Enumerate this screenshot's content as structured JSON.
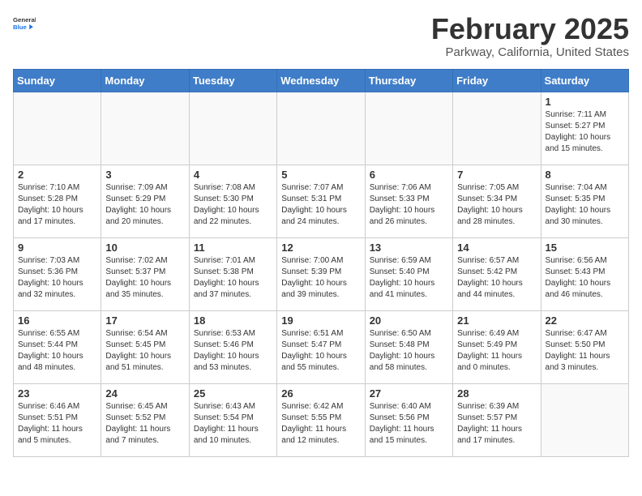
{
  "header": {
    "logo_general": "General",
    "logo_blue": "Blue",
    "month_title": "February 2025",
    "location": "Parkway, California, United States"
  },
  "weekdays": [
    "Sunday",
    "Monday",
    "Tuesday",
    "Wednesday",
    "Thursday",
    "Friday",
    "Saturday"
  ],
  "weeks": [
    [
      {
        "day": "",
        "info": ""
      },
      {
        "day": "",
        "info": ""
      },
      {
        "day": "",
        "info": ""
      },
      {
        "day": "",
        "info": ""
      },
      {
        "day": "",
        "info": ""
      },
      {
        "day": "",
        "info": ""
      },
      {
        "day": "1",
        "info": "Sunrise: 7:11 AM\nSunset: 5:27 PM\nDaylight: 10 hours\nand 15 minutes."
      }
    ],
    [
      {
        "day": "2",
        "info": "Sunrise: 7:10 AM\nSunset: 5:28 PM\nDaylight: 10 hours\nand 17 minutes."
      },
      {
        "day": "3",
        "info": "Sunrise: 7:09 AM\nSunset: 5:29 PM\nDaylight: 10 hours\nand 20 minutes."
      },
      {
        "day": "4",
        "info": "Sunrise: 7:08 AM\nSunset: 5:30 PM\nDaylight: 10 hours\nand 22 minutes."
      },
      {
        "day": "5",
        "info": "Sunrise: 7:07 AM\nSunset: 5:31 PM\nDaylight: 10 hours\nand 24 minutes."
      },
      {
        "day": "6",
        "info": "Sunrise: 7:06 AM\nSunset: 5:33 PM\nDaylight: 10 hours\nand 26 minutes."
      },
      {
        "day": "7",
        "info": "Sunrise: 7:05 AM\nSunset: 5:34 PM\nDaylight: 10 hours\nand 28 minutes."
      },
      {
        "day": "8",
        "info": "Sunrise: 7:04 AM\nSunset: 5:35 PM\nDaylight: 10 hours\nand 30 minutes."
      }
    ],
    [
      {
        "day": "9",
        "info": "Sunrise: 7:03 AM\nSunset: 5:36 PM\nDaylight: 10 hours\nand 32 minutes."
      },
      {
        "day": "10",
        "info": "Sunrise: 7:02 AM\nSunset: 5:37 PM\nDaylight: 10 hours\nand 35 minutes."
      },
      {
        "day": "11",
        "info": "Sunrise: 7:01 AM\nSunset: 5:38 PM\nDaylight: 10 hours\nand 37 minutes."
      },
      {
        "day": "12",
        "info": "Sunrise: 7:00 AM\nSunset: 5:39 PM\nDaylight: 10 hours\nand 39 minutes."
      },
      {
        "day": "13",
        "info": "Sunrise: 6:59 AM\nSunset: 5:40 PM\nDaylight: 10 hours\nand 41 minutes."
      },
      {
        "day": "14",
        "info": "Sunrise: 6:57 AM\nSunset: 5:42 PM\nDaylight: 10 hours\nand 44 minutes."
      },
      {
        "day": "15",
        "info": "Sunrise: 6:56 AM\nSunset: 5:43 PM\nDaylight: 10 hours\nand 46 minutes."
      }
    ],
    [
      {
        "day": "16",
        "info": "Sunrise: 6:55 AM\nSunset: 5:44 PM\nDaylight: 10 hours\nand 48 minutes."
      },
      {
        "day": "17",
        "info": "Sunrise: 6:54 AM\nSunset: 5:45 PM\nDaylight: 10 hours\nand 51 minutes."
      },
      {
        "day": "18",
        "info": "Sunrise: 6:53 AM\nSunset: 5:46 PM\nDaylight: 10 hours\nand 53 minutes."
      },
      {
        "day": "19",
        "info": "Sunrise: 6:51 AM\nSunset: 5:47 PM\nDaylight: 10 hours\nand 55 minutes."
      },
      {
        "day": "20",
        "info": "Sunrise: 6:50 AM\nSunset: 5:48 PM\nDaylight: 10 hours\nand 58 minutes."
      },
      {
        "day": "21",
        "info": "Sunrise: 6:49 AM\nSunset: 5:49 PM\nDaylight: 11 hours\nand 0 minutes."
      },
      {
        "day": "22",
        "info": "Sunrise: 6:47 AM\nSunset: 5:50 PM\nDaylight: 11 hours\nand 3 minutes."
      }
    ],
    [
      {
        "day": "23",
        "info": "Sunrise: 6:46 AM\nSunset: 5:51 PM\nDaylight: 11 hours\nand 5 minutes."
      },
      {
        "day": "24",
        "info": "Sunrise: 6:45 AM\nSunset: 5:52 PM\nDaylight: 11 hours\nand 7 minutes."
      },
      {
        "day": "25",
        "info": "Sunrise: 6:43 AM\nSunset: 5:54 PM\nDaylight: 11 hours\nand 10 minutes."
      },
      {
        "day": "26",
        "info": "Sunrise: 6:42 AM\nSunset: 5:55 PM\nDaylight: 11 hours\nand 12 minutes."
      },
      {
        "day": "27",
        "info": "Sunrise: 6:40 AM\nSunset: 5:56 PM\nDaylight: 11 hours\nand 15 minutes."
      },
      {
        "day": "28",
        "info": "Sunrise: 6:39 AM\nSunset: 5:57 PM\nDaylight: 11 hours\nand 17 minutes."
      },
      {
        "day": "",
        "info": ""
      }
    ]
  ]
}
